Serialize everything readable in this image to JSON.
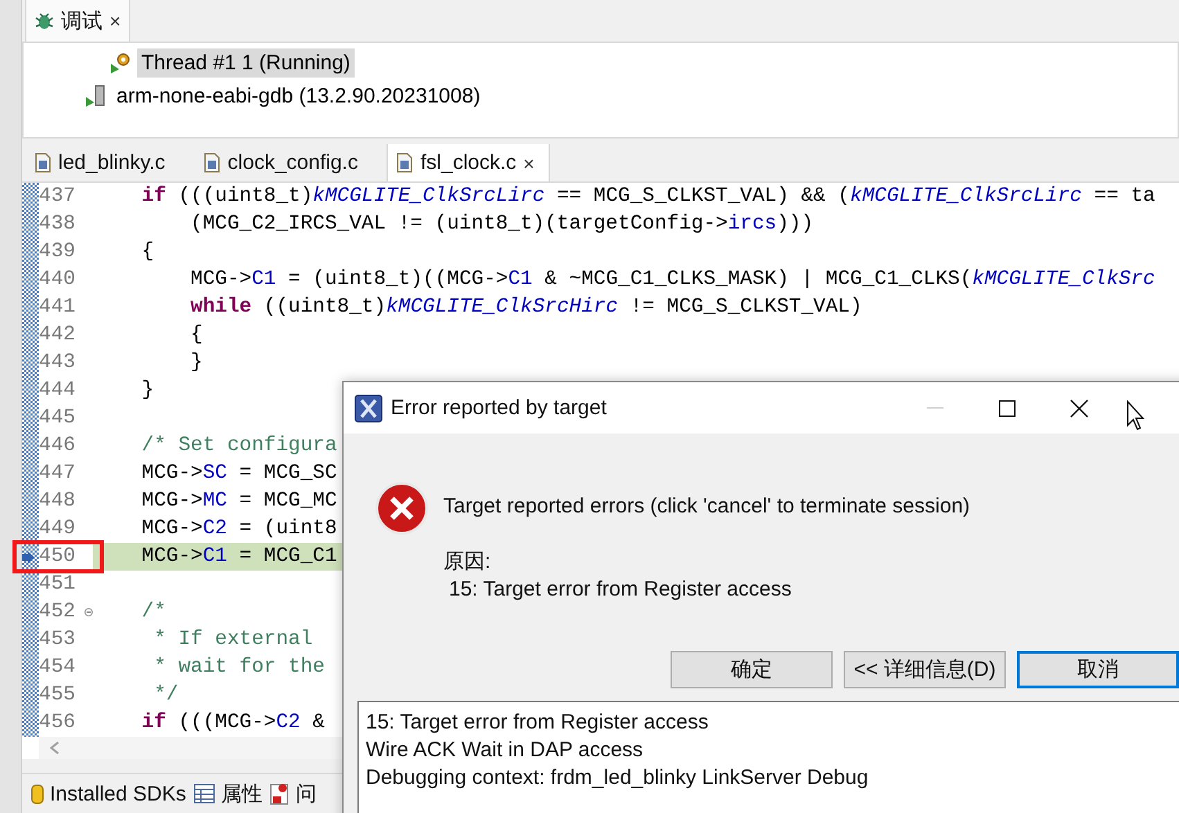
{
  "debug_view": {
    "tab": {
      "label": "调试",
      "close": "×"
    },
    "tree": [
      {
        "label": "Thread #1 1 (Running)",
        "kind": "thread",
        "selected": true
      },
      {
        "label": "arm-none-eabi-gdb (13.2.90.20231008)",
        "kind": "gdb",
        "selected": false
      }
    ]
  },
  "editor": {
    "tabs": [
      {
        "label": "led_blinky.c",
        "selected": false
      },
      {
        "label": "clock_config.c",
        "selected": false
      },
      {
        "label": "fsl_clock.c",
        "selected": true,
        "close": "×"
      }
    ],
    "lines": [
      {
        "number": "437",
        "current": false,
        "foldable": false,
        "segments": [
          {
            "kind": "keyword",
            "text": "    if"
          },
          {
            "kind": "plain",
            "text": " (((uint8_t)"
          },
          {
            "kind": "macro",
            "text": "kMCGLITE_ClkSrcLirc"
          },
          {
            "kind": "plain",
            "text": " == MCG_S_CLKST_VAL) && ("
          },
          {
            "kind": "macro",
            "text": "kMCGLITE_ClkSrcLirc"
          },
          {
            "kind": "plain",
            "text": " == ta"
          }
        ]
      },
      {
        "number": "438",
        "current": false,
        "foldable": false,
        "segments": [
          {
            "kind": "plain",
            "text": "        (MCG_C2_IRCS_VAL != (uint8_t)(targetConfig->"
          },
          {
            "kind": "field",
            "text": "ircs"
          },
          {
            "kind": "plain",
            "text": ")))"
          }
        ]
      },
      {
        "number": "439",
        "current": false,
        "foldable": false,
        "segments": [
          {
            "kind": "plain",
            "text": "    {"
          }
        ]
      },
      {
        "number": "440",
        "current": false,
        "foldable": false,
        "segments": [
          {
            "kind": "plain",
            "text": "        MCG->"
          },
          {
            "kind": "field",
            "text": "C1"
          },
          {
            "kind": "plain",
            "text": " = (uint8_t)((MCG->"
          },
          {
            "kind": "field",
            "text": "C1"
          },
          {
            "kind": "plain",
            "text": " & ~MCG_C1_CLKS_MASK) | MCG_C1_CLKS("
          },
          {
            "kind": "macro",
            "text": "kMCGLITE_ClkSrc"
          }
        ]
      },
      {
        "number": "441",
        "current": false,
        "foldable": false,
        "segments": [
          {
            "kind": "keyword",
            "text": "        while"
          },
          {
            "kind": "plain",
            "text": " ((uint8_t)"
          },
          {
            "kind": "macro",
            "text": "kMCGLITE_ClkSrcHirc"
          },
          {
            "kind": "plain",
            "text": " != MCG_S_CLKST_VAL)"
          }
        ]
      },
      {
        "number": "442",
        "current": false,
        "foldable": false,
        "segments": [
          {
            "kind": "plain",
            "text": "        {"
          }
        ]
      },
      {
        "number": "443",
        "current": false,
        "foldable": false,
        "segments": [
          {
            "kind": "plain",
            "text": "        }"
          }
        ]
      },
      {
        "number": "444",
        "current": false,
        "foldable": false,
        "segments": [
          {
            "kind": "plain",
            "text": "    }"
          }
        ]
      },
      {
        "number": "445",
        "current": false,
        "foldable": false
      },
      {
        "number": "446",
        "current": false,
        "foldable": false,
        "segments": [
          {
            "kind": "comment",
            "text": "    /* Set configura"
          }
        ]
      },
      {
        "number": "447",
        "current": false,
        "foldable": false,
        "segments": [
          {
            "kind": "plain",
            "text": "    MCG->"
          },
          {
            "kind": "field",
            "text": "SC"
          },
          {
            "kind": "plain",
            "text": " = MCG_SC"
          }
        ]
      },
      {
        "number": "448",
        "current": false,
        "foldable": false,
        "segments": [
          {
            "kind": "plain",
            "text": "    MCG->"
          },
          {
            "kind": "field",
            "text": "MC"
          },
          {
            "kind": "plain",
            "text": " = MCG_MC"
          }
        ]
      },
      {
        "number": "449",
        "current": false,
        "foldable": false,
        "segments": [
          {
            "kind": "plain",
            "text": "    MCG->"
          },
          {
            "kind": "field",
            "text": "C2"
          },
          {
            "kind": "plain",
            "text": " = (uint8"
          }
        ]
      },
      {
        "number": "450",
        "current": true,
        "foldable": false,
        "segments": [
          {
            "kind": "plain",
            "text": "    MCG->"
          },
          {
            "kind": "field",
            "text": "C1"
          },
          {
            "kind": "plain",
            "text": " = MCG_C1"
          }
        ]
      },
      {
        "number": "451",
        "current": false,
        "foldable": false
      },
      {
        "number": "452",
        "current": false,
        "foldable": true,
        "segments": [
          {
            "kind": "comment",
            "text": "    /*"
          }
        ]
      },
      {
        "number": "453",
        "current": false,
        "foldable": false,
        "segments": [
          {
            "kind": "comment",
            "text": "     * If external"
          }
        ]
      },
      {
        "number": "454",
        "current": false,
        "foldable": false,
        "segments": [
          {
            "kind": "comment",
            "text": "     * wait for the"
          }
        ]
      },
      {
        "number": "455",
        "current": false,
        "foldable": false,
        "segments": [
          {
            "kind": "comment",
            "text": "     */"
          }
        ]
      },
      {
        "number": "456",
        "current": false,
        "foldable": false,
        "segments": [
          {
            "kind": "keyword",
            "text": "    if"
          },
          {
            "kind": "plain",
            "text": " (((MCG->"
          },
          {
            "kind": "field",
            "text": "C2"
          },
          {
            "kind": "plain",
            "text": " &"
          }
        ]
      }
    ]
  },
  "bottom_tabs": [
    {
      "label": "Installed SDKs",
      "kind": "sdk"
    },
    {
      "label": "属性",
      "kind": "properties"
    },
    {
      "label": "问",
      "kind": "problems"
    }
  ],
  "dialog": {
    "title": "Error reported by target",
    "message": "Target reported errors (click 'cancel' to terminate session)",
    "reason_label": "原因:",
    "reason": "15: Target error from Register access",
    "buttons": [
      {
        "label": "确定",
        "selected": false
      },
      {
        "label": "<< 详细信息(D)",
        "selected": false
      },
      {
        "label": "取消",
        "selected": true
      }
    ],
    "details": [
      "15: Target error from Register access",
      "Wire ACK Wait in DAP access",
      "Debugging context: frdm_led_blinky LinkServer Debug"
    ]
  }
}
